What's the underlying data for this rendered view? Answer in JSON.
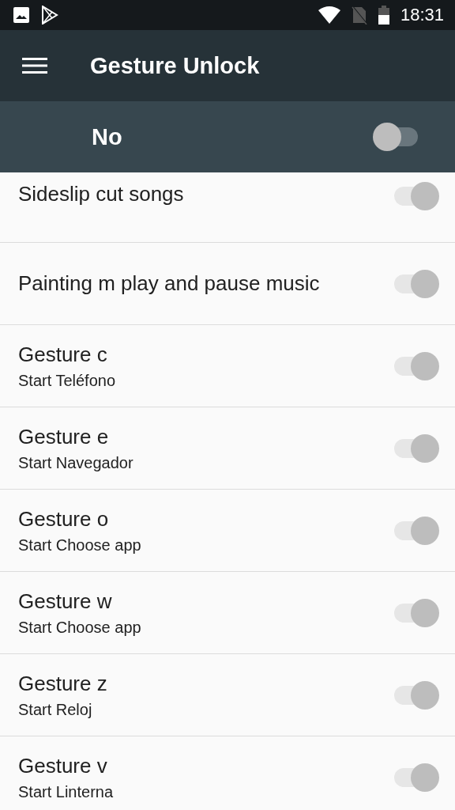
{
  "status_bar": {
    "time": "18:31"
  },
  "toolbar": {
    "title": "Gesture Unlock"
  },
  "master_switch": {
    "label": "No",
    "on": false
  },
  "items": [
    {
      "title": "Sideslip cut songs",
      "on": true,
      "disabled": true
    },
    {
      "title": "Painting m play and pause music",
      "on": true,
      "disabled": true
    },
    {
      "title": "Gesture c",
      "subtitle": "Start Teléfono",
      "on": true,
      "disabled": true
    },
    {
      "title": "Gesture e",
      "subtitle": "Start Navegador",
      "on": true,
      "disabled": true
    },
    {
      "title": "Gesture o",
      "subtitle": "Start Choose app",
      "on": true,
      "disabled": true
    },
    {
      "title": "Gesture w",
      "subtitle": "Start Choose app",
      "on": true,
      "disabled": true
    },
    {
      "title": "Gesture z",
      "subtitle": "Start Reloj",
      "on": true,
      "disabled": true
    },
    {
      "title": "Gesture v",
      "subtitle": "Start Linterna",
      "on": true,
      "disabled": true
    }
  ]
}
